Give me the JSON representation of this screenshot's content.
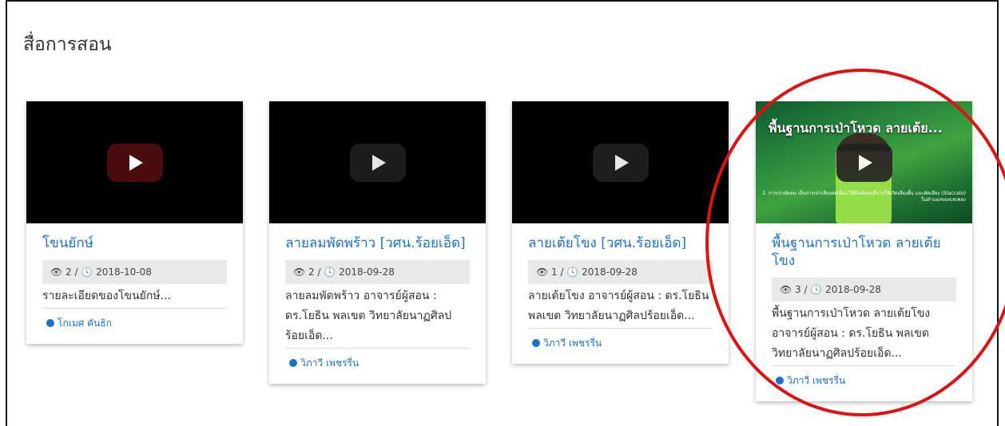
{
  "section": {
    "title": "สื่อการสอน"
  },
  "cards": [
    {
      "title": "โขนยักษ์",
      "meta": "👁 2 / 🕓 2018-10-08",
      "description": "รายละเอียดของโขนยักษ์...",
      "author": "โกเมศ คันธิก",
      "thumb": {
        "style": "black",
        "play_color": "#4a0c0c"
      }
    },
    {
      "title": "ลายลมพัดพร้าว [วศน.ร้อยเอ็ด]",
      "meta": "👁 2 / 🕓 2018-09-28",
      "description": "ลายลมพัดพร้าว อาจารย์ผู้สอน : ดร.โยธิน พลเขต วิทยาลัยนาฏศิลปร้อยเอ็ด...",
      "author": "วิภาวี เพชรรื่น",
      "thumb": {
        "style": "black",
        "play_color": "#212121"
      }
    },
    {
      "title": "ลายเต้ยโขง [วศน.ร้อยเอ็ด]",
      "meta": "👁 1 / 🕓 2018-09-28",
      "description": "ลายเต้ยโขง อาจารย์ผู้สอน : ดร.โยธิน พลเขต วิทยาลัยนาฏศิลปร้อยเอ็ด...",
      "author": "วิภาวี เพชรรื่น",
      "thumb": {
        "style": "black",
        "play_color": "#212121"
      }
    },
    {
      "title": "พื้นฐานการเป่าโหวด ลายเต้ยโขง",
      "meta": "👁 3 / 🕓 2018-09-28",
      "description": "พื้นฐานการเป่าโหวด ลายเต้ยโขง อาจารย์ผู้สอน : ดร.โยธิน พลเขต วิทยาลัยนาฏศิลปร้อยเอ็ด...",
      "author": "วิภาวี เพชรรื่น",
      "thumb": {
        "style": "photo",
        "overlay_title": "พื้นฐานการเป่าโหวด ลายเต้ย...",
        "caption": "2. การเป่าตัดลม เป็นการเป่าเสียงต่อเนื่อง ใช้ลิ้นตัดลมที่ปากให้เกิดเสียงสั้น และตัดเสียง (Staccato) ในทำนองของบทเพลง",
        "play_color": "#212121"
      }
    }
  ],
  "annotation": {
    "color": "#e11111"
  }
}
